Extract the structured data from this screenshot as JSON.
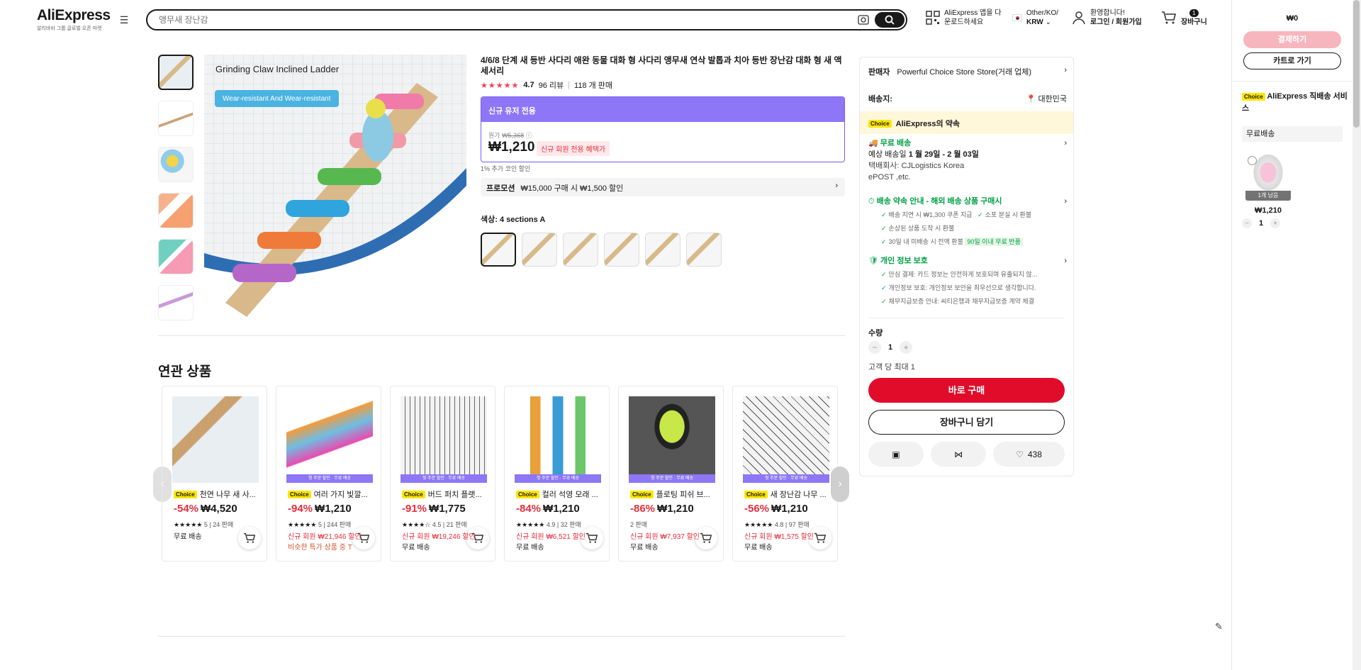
{
  "header": {
    "logo": "AliExpress",
    "logo_sub": "알리바바 그룹 글로벌 오픈 마켓",
    "search_placeholder": "앵무새 장난감",
    "app_line1": "AliExpress 앱을 다",
    "app_line2": "운로드하세요",
    "locale_line1": "Other/KO/",
    "locale_line2": "KRW",
    "welcome_line1": "환영합니다!",
    "welcome_line2": "로그인 / 회원가입",
    "cart_count": "1",
    "cart_label": "장바구니"
  },
  "product": {
    "title": "4/6/8 단계 새 등반 사다리 애완 동물 대화 형 사다리 앵무새 연삭 발톱과 치아 등반 장난감 대화 형 새 액세서리",
    "image_caption1": "Grinding Claw Inclined Ladder",
    "image_caption2": "Wear-resistant And Wear-resistant",
    "rating": "4.7",
    "reviews": "96 리뷰",
    "sold": "118 개 판매",
    "new_user_bar": "신규 유저 전용",
    "orig_label": "원가",
    "orig_price": "₩5,368",
    "price": "₩1,210",
    "new_member_badge": "신규 회원 전용 혜택가",
    "coin": "1% 추가 코인 할인",
    "promo_label": "프로모션",
    "promo_text": "₩15,000 구매 시 ₩1,500 할인",
    "color_label": "색상: 4 sections A"
  },
  "related": {
    "title": "연관 상품",
    "items": [
      {
        "name": "천연 나무 새 사...",
        "disc": "-54%",
        "price": "₩4,520",
        "rating": "5",
        "sold": "24 판매",
        "l1": "무료 배송",
        "l2": "",
        "strip": ""
      },
      {
        "name": "여러 가지 빛깔...",
        "disc": "-94%",
        "price": "₩1,210",
        "rating": "5",
        "sold": "244 판매",
        "l1": "신규 회원 ₩21,946 할인",
        "l2": "비슷한 특가 상품 중 T",
        "strip": "첫 주문 할인 · 무료 배송"
      },
      {
        "name": "버드 퍼치 플랫...",
        "disc": "-91%",
        "price": "₩1,775",
        "rating": "4.5",
        "sold": "21 판매",
        "l1": "신규 회원 ₩19,246 할인",
        "l2": "무료 배송",
        "strip": "첫 주문 할인 · 무료 배송"
      },
      {
        "name": "컬러 석영 모래 ...",
        "disc": "-84%",
        "price": "₩1,210",
        "rating": "4.9",
        "sold": "32 판매",
        "l1": "신규 회원 ₩6,521 할인",
        "l2": "무료 배송",
        "strip": "첫 주문 할인 · 무료 배송"
      },
      {
        "name": "플로팅 피쉬 브...",
        "disc": "-86%",
        "price": "₩1,210",
        "rating": "",
        "sold": "2 판매",
        "l1": "신규 회원 ₩7,937 할인",
        "l2": "무료 배송",
        "strip": "첫 주문 할인 · 무료 배송"
      },
      {
        "name": "새 장난감 나무 ...",
        "disc": "-56%",
        "price": "₩1,210",
        "rating": "4.8",
        "sold": "97 판매",
        "l1": "신규 회원 ₩1,575 할인",
        "l2": "무료 배송",
        "strip": "첫 주문 할인 · 무료 배송"
      }
    ]
  },
  "buybox": {
    "seller_label": "판매자",
    "seller": "Powerful Choice Store Store(거래 업체)",
    "ship_to_label": "배송지:",
    "ship_to": "대한민국",
    "choice_badge": "Choice",
    "choice_promise": "AliExpress의 약속",
    "free_ship": "무료 배송",
    "est_label": "예상 배송일",
    "est_date": "1 월 29일 - 2 월 03일",
    "carrier_label": "택배회사:",
    "carrier1": "CJLogistics",
    "carrier2": "Korea",
    "carrier3": "ePOST ,etc.",
    "promise_title": "배송 약속 안내 - 해외 배송 상품 구매시",
    "promise_items": [
      "배송 지연 시 ₩1,300 쿠폰 지급",
      "소포 분실 시 환불",
      "손상된 상품 도착 시 환불",
      "30일 내 미배송 시 전액 환불"
    ],
    "return_badge": "90일 이내 무료 반품",
    "privacy_title": "개인 정보 보호",
    "privacy_items": [
      "안심 결제: 카드 정보는 안전하게 보호되며 유출되지 않...",
      "개인정보 보호: 개인정보 보안을 최우선으로 생각합니다.",
      "채무지급보증 안내: 씨티은행과 채무지급보증 계약 체결"
    ],
    "qty_label": "수량",
    "qty": "1",
    "limit": "고객 당 최대 1",
    "buy_now": "바로 구매",
    "add_cart": "장바구니 담기",
    "wish_count": "438"
  },
  "cartpanel": {
    "total": "₩0",
    "checkout": "결제하기",
    "go_cart": "카트로 가기",
    "choice_badge": "Choice",
    "choice_title": "AliExpress 직배송 서비스",
    "free_ship": "무료배송",
    "left_badge": "1개 남음",
    "item_price": "₩1,210",
    "item_qty": "1"
  }
}
